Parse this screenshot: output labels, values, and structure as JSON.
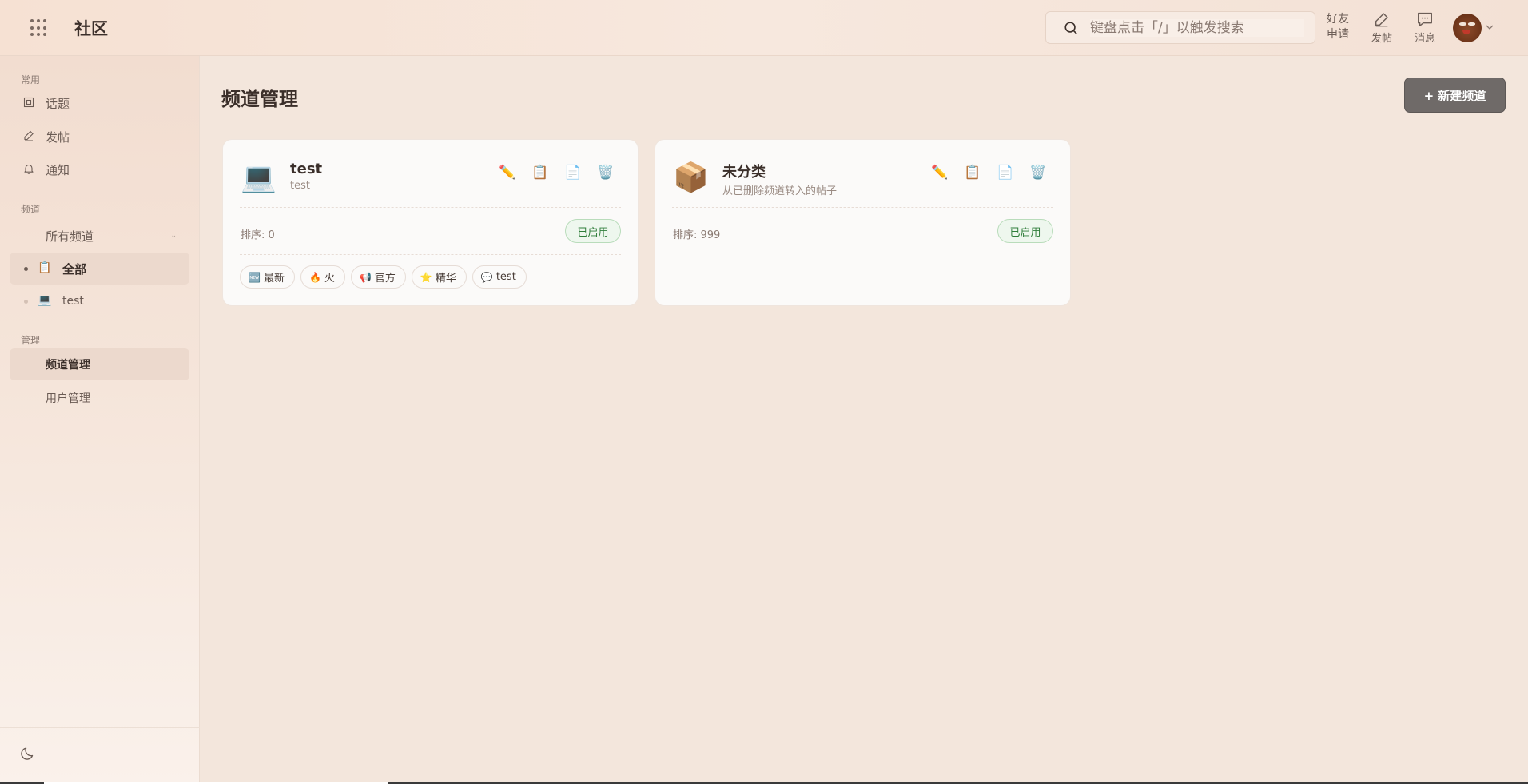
{
  "header": {
    "brand": "社区",
    "search_placeholder": "键盘点击「/」以触发搜索",
    "friend_line1": "好友",
    "friend_line2": "申请",
    "post_label": "发帖",
    "message_label": "消息"
  },
  "sidebar": {
    "common_title": "常用",
    "common_items": [
      "话题",
      "发帖",
      "通知"
    ],
    "channel_title": "频道",
    "all_channels": "所有频道",
    "channel_items": [
      {
        "label": "全部",
        "icon": "📋"
      },
      {
        "label": "test",
        "icon": "💻"
      }
    ],
    "manage_title": "管理",
    "manage_items": [
      "频道管理",
      "用户管理"
    ]
  },
  "main": {
    "title": "频道管理",
    "new_button": "+ 新建频道",
    "cards": [
      {
        "icon": "💻",
        "name": "test",
        "desc": "test",
        "order": "排序: 0",
        "status": "已启用",
        "tags": [
          {
            "icon": "🆕",
            "label": "最新"
          },
          {
            "icon": "🔥",
            "label": "火"
          },
          {
            "icon": "📢",
            "label": "官方"
          },
          {
            "icon": "⭐",
            "label": "精华"
          },
          {
            "icon": "💬",
            "label": "test"
          }
        ]
      },
      {
        "icon": "📦",
        "name": "未分类",
        "desc": "从已删除频道转入的帖子",
        "order": "排序: 999",
        "status": "已启用",
        "tags": []
      }
    ],
    "action_icons": [
      "✏️",
      "📋",
      "📄",
      "🗑️"
    ]
  },
  "colors": {
    "accent_button": "#6f6a68",
    "status_green": "#2f7d3a",
    "sidebar_active": "#ecd9cd"
  }
}
